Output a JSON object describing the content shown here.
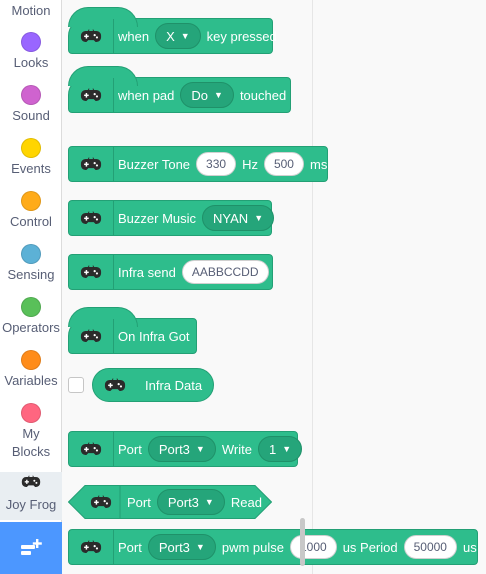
{
  "categories": [
    {
      "label": "Motion",
      "color": "#4c97ff"
    },
    {
      "label": "Looks",
      "color": "#9966ff"
    },
    {
      "label": "Sound",
      "color": "#cf63cf"
    },
    {
      "label": "Events",
      "color": "#ffd500"
    },
    {
      "label": "Control",
      "color": "#ffab19"
    },
    {
      "label": "Sensing",
      "color": "#5cb1d6"
    },
    {
      "label": "Operators",
      "color": "#59c059"
    },
    {
      "label": "Variables",
      "color": "#ff8c1a"
    },
    {
      "label": "My Blocks",
      "color": "#ff6680"
    },
    {
      "label": "Joy Frog",
      "icon": "gamepad-icon"
    }
  ],
  "extension_button": {
    "icon": "add-extension-icon"
  },
  "blocks": {
    "key_pressed": {
      "pre": "when",
      "key": "X",
      "post": "key pressed"
    },
    "pad_touched": {
      "pre": "when pad",
      "pad": "Do",
      "post": "touched"
    },
    "buzzer_tone": {
      "label": "Buzzer Tone",
      "freq": "330",
      "hz": "Hz",
      "dur": "500",
      "ms": "ms"
    },
    "buzzer_music": {
      "label": "Buzzer Music",
      "song": "NYAN"
    },
    "infra_send": {
      "label": "Infra send",
      "value": "AABBCCDD"
    },
    "infra_got": {
      "label": "On Infra Got"
    },
    "infra_data": {
      "label": "Infra Data"
    },
    "port_write": {
      "pre": "Port",
      "port": "Port3",
      "mid": "Write",
      "value": "1"
    },
    "port_read": {
      "pre": "Port",
      "port": "Port3",
      "post": "Read"
    },
    "pwm": {
      "pre": "Port",
      "port": "Port3",
      "mid": "pwm pulse",
      "pulse": "1000",
      "period_label": "us Period",
      "period": "50000",
      "unit": "us"
    }
  },
  "colors": {
    "block": "#2ebd8c",
    "block_border": "#23a075",
    "accent": "#4c97ff"
  }
}
